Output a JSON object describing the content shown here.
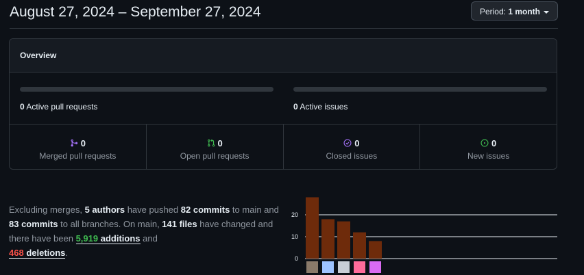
{
  "header": {
    "title": "August 27, 2024 – September 27, 2024",
    "period_prefix": "Period:",
    "period_value": "1 month"
  },
  "overview": {
    "heading": "Overview",
    "pull_requests": {
      "count": "0",
      "label": "Active pull requests"
    },
    "issues": {
      "count": "0",
      "label": "Active issues"
    },
    "stats": [
      {
        "count": "0",
        "label": "Merged pull requests",
        "icon": "merge-icon",
        "color": "#a371f7"
      },
      {
        "count": "0",
        "label": "Open pull requests",
        "icon": "pull-request-icon",
        "color": "#3fb950"
      },
      {
        "count": "0",
        "label": "Closed issues",
        "icon": "issue-closed-icon",
        "color": "#a371f7"
      },
      {
        "count": "0",
        "label": "New issues",
        "icon": "issue-opened-icon",
        "color": "#3fb950"
      }
    ]
  },
  "summary": {
    "t1": "Excluding merges, ",
    "authors": "5 authors",
    "t2": " have pushed ",
    "commits_main": "82 commits",
    "t3": " to main and ",
    "commits_all": "83 commits",
    "t4": " to all branches. On main, ",
    "files": "141 files",
    "t5": " have changed and there have been ",
    "additions_num": "5,919",
    "additions_word": " additions",
    "t6": " and ",
    "deletions_num": "468",
    "deletions_word": " deletions",
    "t7": "."
  },
  "chart_data": {
    "type": "bar",
    "categories": [
      "author-1",
      "author-2",
      "author-3",
      "author-4",
      "author-5"
    ],
    "values": [
      28,
      18,
      17,
      12,
      8
    ],
    "ylim": [
      0,
      30
    ],
    "yticks": [
      "0",
      "10",
      "20"
    ],
    "bar_color": "#6e2b0b"
  }
}
